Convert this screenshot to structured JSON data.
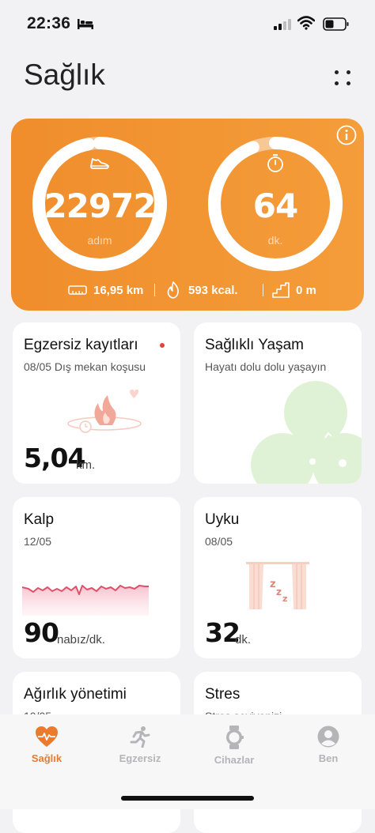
{
  "status_bar": {
    "time": "22:36"
  },
  "header": {
    "title": "Sağlık"
  },
  "hero": {
    "steps_value": "22972",
    "steps_unit": "adım",
    "minutes_value": "64",
    "minutes_unit": "dk.",
    "distance": "16,95 km",
    "calories": "593 kcal.",
    "climb": "0 m",
    "steps_ring_progress": 0.97,
    "minutes_ring_progress": 0.94
  },
  "cards": {
    "exercise": {
      "title": "Egzersiz kayıtları",
      "subtitle": "08/05 Dış mekan koşusu",
      "value": "5,04",
      "unit": "km."
    },
    "healthy_living": {
      "title": "Sağlıklı Yaşam",
      "subtitle": "Hayatı dolu dolu yaşayın"
    },
    "heart": {
      "title": "Kalp",
      "subtitle": "12/05",
      "value": "90",
      "unit": "nabız/dk."
    },
    "sleep": {
      "title": "Uyku",
      "subtitle": "08/05",
      "value": "32",
      "unit": "dk."
    },
    "weight": {
      "title": "Ağırlık yönetimi",
      "subtitle": "10/05"
    },
    "stress": {
      "title": "Stres",
      "subtitle": "Stres seviyenizi"
    }
  },
  "tabs": [
    {
      "label": "Sağlık",
      "icon": "heart-pulse-icon",
      "active": true
    },
    {
      "label": "Egzersiz",
      "icon": "runner-icon",
      "active": false
    },
    {
      "label": "Cihazlar",
      "icon": "watch-icon",
      "active": false
    },
    {
      "label": "Ben",
      "icon": "user-icon",
      "active": false
    }
  ],
  "colors": {
    "accent": "#ec7a2c",
    "hero_start": "#f08d2c",
    "hero_end": "#f49d3a",
    "heart_line": "#e0506a",
    "healthy_green": "#dff2d6"
  }
}
